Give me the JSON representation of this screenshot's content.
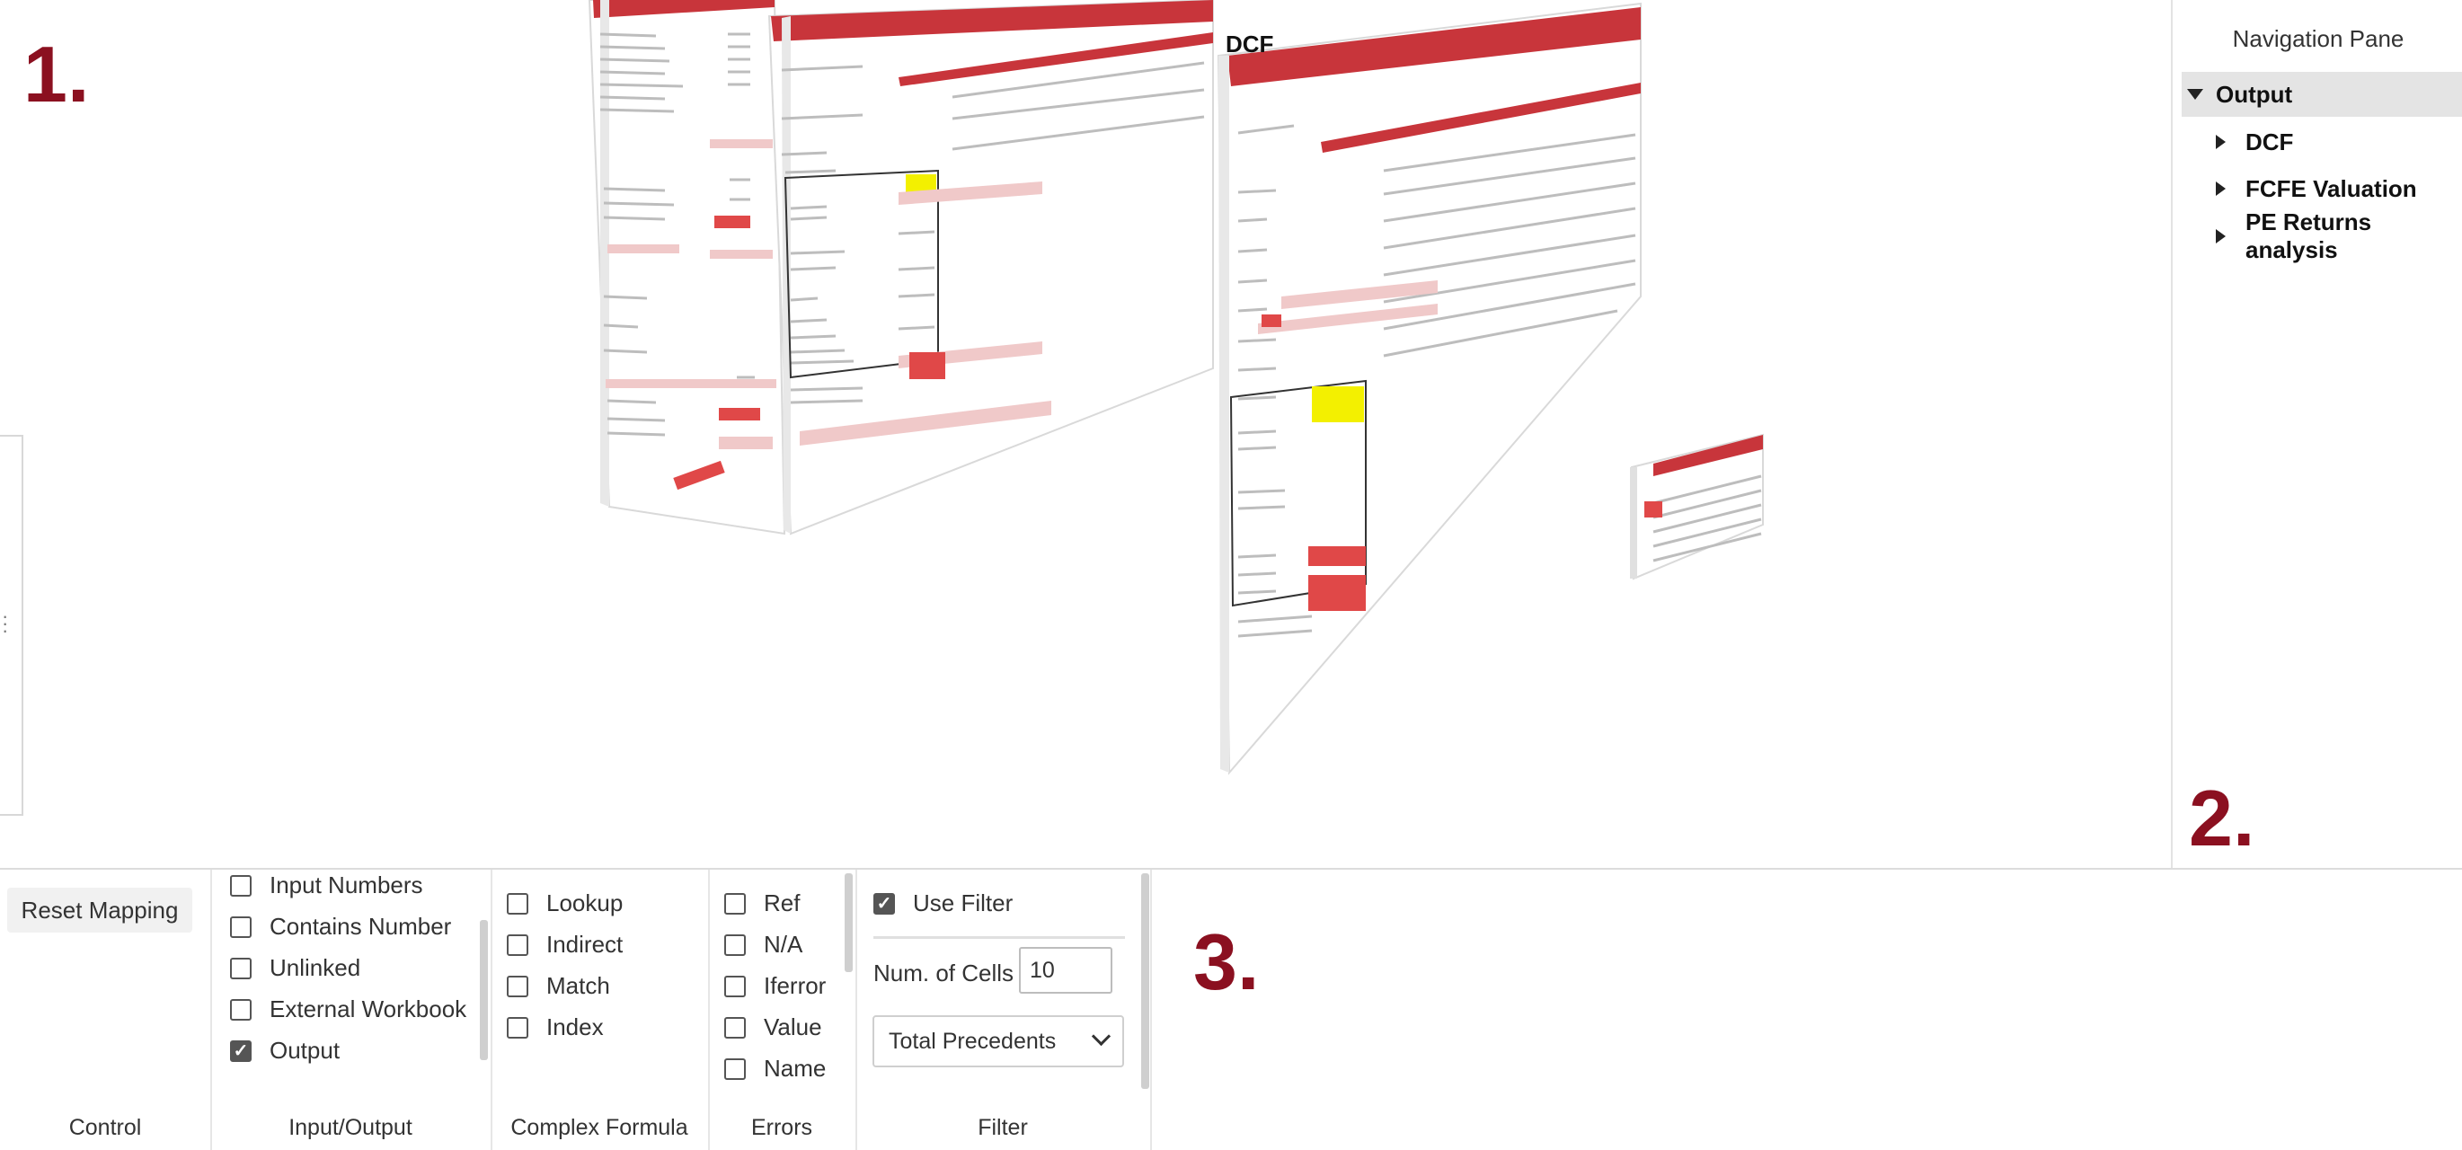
{
  "canvas": {
    "labels": {
      "one": "1.",
      "two": "2.",
      "three": "3."
    },
    "sheet_title": "DCF"
  },
  "nav": {
    "title": "Navigation Pane",
    "root": "Output",
    "children": [
      "DCF",
      "FCFE Valuation",
      "PE Returns analysis"
    ]
  },
  "ribbon": {
    "control": {
      "reset_label": "Reset Mapping",
      "group_label": "Control"
    },
    "input_output": {
      "group_label": "Input/Output",
      "options": [
        {
          "label": "Input Numbers",
          "checked": false
        },
        {
          "label": "Contains Number",
          "checked": false
        },
        {
          "label": "Unlinked",
          "checked": false
        },
        {
          "label": "External Workbook",
          "checked": false
        },
        {
          "label": "Output",
          "checked": true
        }
      ]
    },
    "complex_formula": {
      "group_label": "Complex Formula",
      "options": [
        {
          "label": "Lookup",
          "checked": false
        },
        {
          "label": "Indirect",
          "checked": false
        },
        {
          "label": "Match",
          "checked": false
        },
        {
          "label": "Index",
          "checked": false
        }
      ]
    },
    "errors": {
      "group_label": "Errors",
      "options": [
        {
          "label": "Ref",
          "checked": false
        },
        {
          "label": "N/A",
          "checked": false
        },
        {
          "label": "Iferror",
          "checked": false
        },
        {
          "label": "Value",
          "checked": false
        },
        {
          "label": "Name",
          "checked": false
        }
      ]
    },
    "filter": {
      "group_label": "Filter",
      "use_filter_label": "Use Filter",
      "use_filter_checked": true,
      "num_cells_label": "Num. of Cells",
      "num_cells_value": "10",
      "select_value": "Total Precedents"
    }
  },
  "colors": {
    "accent": "#8b1020",
    "sheet_red": "#c8353b",
    "highlight": "#f3f000"
  }
}
